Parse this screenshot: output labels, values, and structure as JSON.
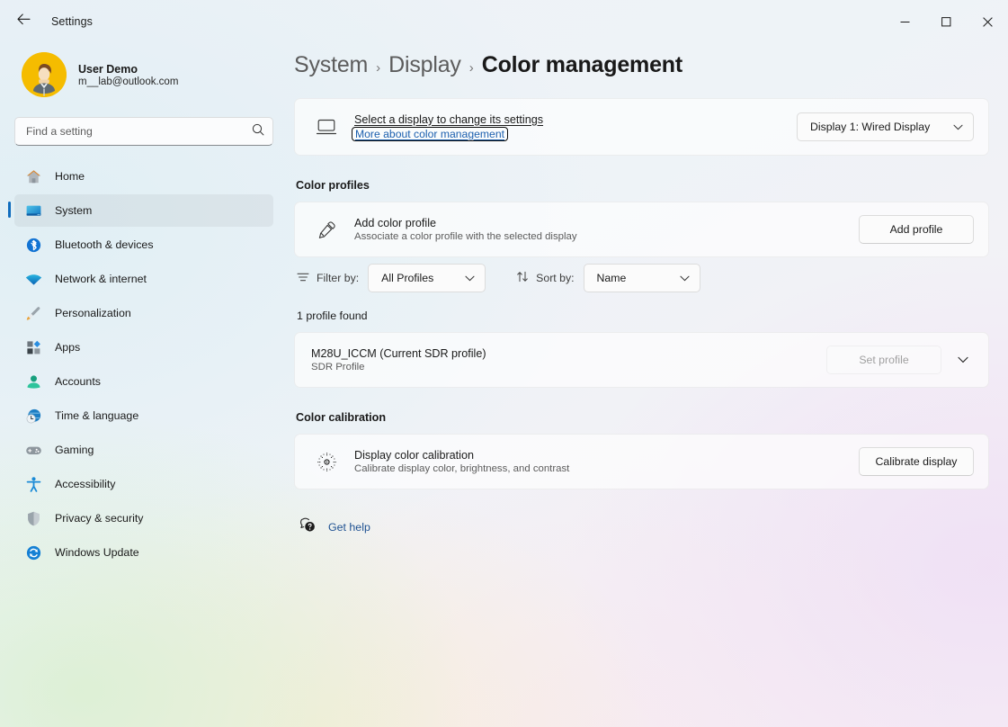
{
  "window": {
    "app_title": "Settings",
    "back_icon": "back-arrow-icon",
    "minimize_label": "Minimize",
    "maximize_label": "Maximize",
    "close_label": "Close"
  },
  "account": {
    "name": "User Demo",
    "email": "m__lab@outlook.com",
    "avatar_color": "#f5bc00"
  },
  "search": {
    "placeholder": "Find a setting",
    "value": "",
    "icon": "search-icon"
  },
  "sidebar": {
    "selected": "System",
    "items": [
      {
        "label": "Home",
        "icon": "home-icon"
      },
      {
        "label": "System",
        "icon": "system-monitor-icon"
      },
      {
        "label": "Bluetooth & devices",
        "icon": "bluetooth-icon"
      },
      {
        "label": "Network & internet",
        "icon": "wifi-icon"
      },
      {
        "label": "Personalization",
        "icon": "paintbrush-icon"
      },
      {
        "label": "Apps",
        "icon": "apps-icon"
      },
      {
        "label": "Accounts",
        "icon": "person-icon"
      },
      {
        "label": "Time & language",
        "icon": "clock-globe-icon"
      },
      {
        "label": "Gaming",
        "icon": "gamepad-icon"
      },
      {
        "label": "Accessibility",
        "icon": "accessibility-icon"
      },
      {
        "label": "Privacy & security",
        "icon": "shield-icon"
      },
      {
        "label": "Windows Update",
        "icon": "update-refresh-icon"
      }
    ]
  },
  "breadcrumb": {
    "level1": "System",
    "level2": "Display",
    "level3": "Color management",
    "separator": "›"
  },
  "display_card": {
    "icon": "monitor-icon",
    "heading": "Select a display to change its settings",
    "link": "More about color management",
    "link_focused": true,
    "dropdown_value": "Display 1: Wired Display",
    "dropdown_icon": "chevron-down-icon"
  },
  "color_profiles": {
    "section_title": "Color profiles",
    "add_card": {
      "icon": "eyedropper-icon",
      "title": "Add color profile",
      "subtitle": "Associate a color profile with the selected display",
      "button": "Add profile"
    },
    "filter": {
      "icon": "filter-icon",
      "label": "Filter by:",
      "value": "All Profiles",
      "chevron": "chevron-down-icon"
    },
    "sort": {
      "icon": "sort-arrows-icon",
      "label": "Sort by:",
      "value": "Name",
      "chevron": "chevron-down-icon"
    },
    "count_text": "1 profile found",
    "profiles": [
      {
        "name": "M28U_ICCM (Current SDR profile)",
        "type": "SDR Profile",
        "action_label": "Set profile",
        "action_disabled": true,
        "expand_icon": "chevron-down-icon"
      }
    ]
  },
  "color_calibration": {
    "section_title": "Color calibration",
    "card": {
      "icon": "brightness-icon",
      "title": "Display color calibration",
      "subtitle": "Calibrate display color, brightness, and contrast",
      "button": "Calibrate display"
    }
  },
  "get_help": {
    "label": "Get help",
    "icon": "help-question-icon"
  },
  "colors": {
    "accent": "#0f6cbd",
    "link": "#1b5fae",
    "text_primary": "#1a1a1a",
    "text_secondary": "#5c5c5c"
  }
}
